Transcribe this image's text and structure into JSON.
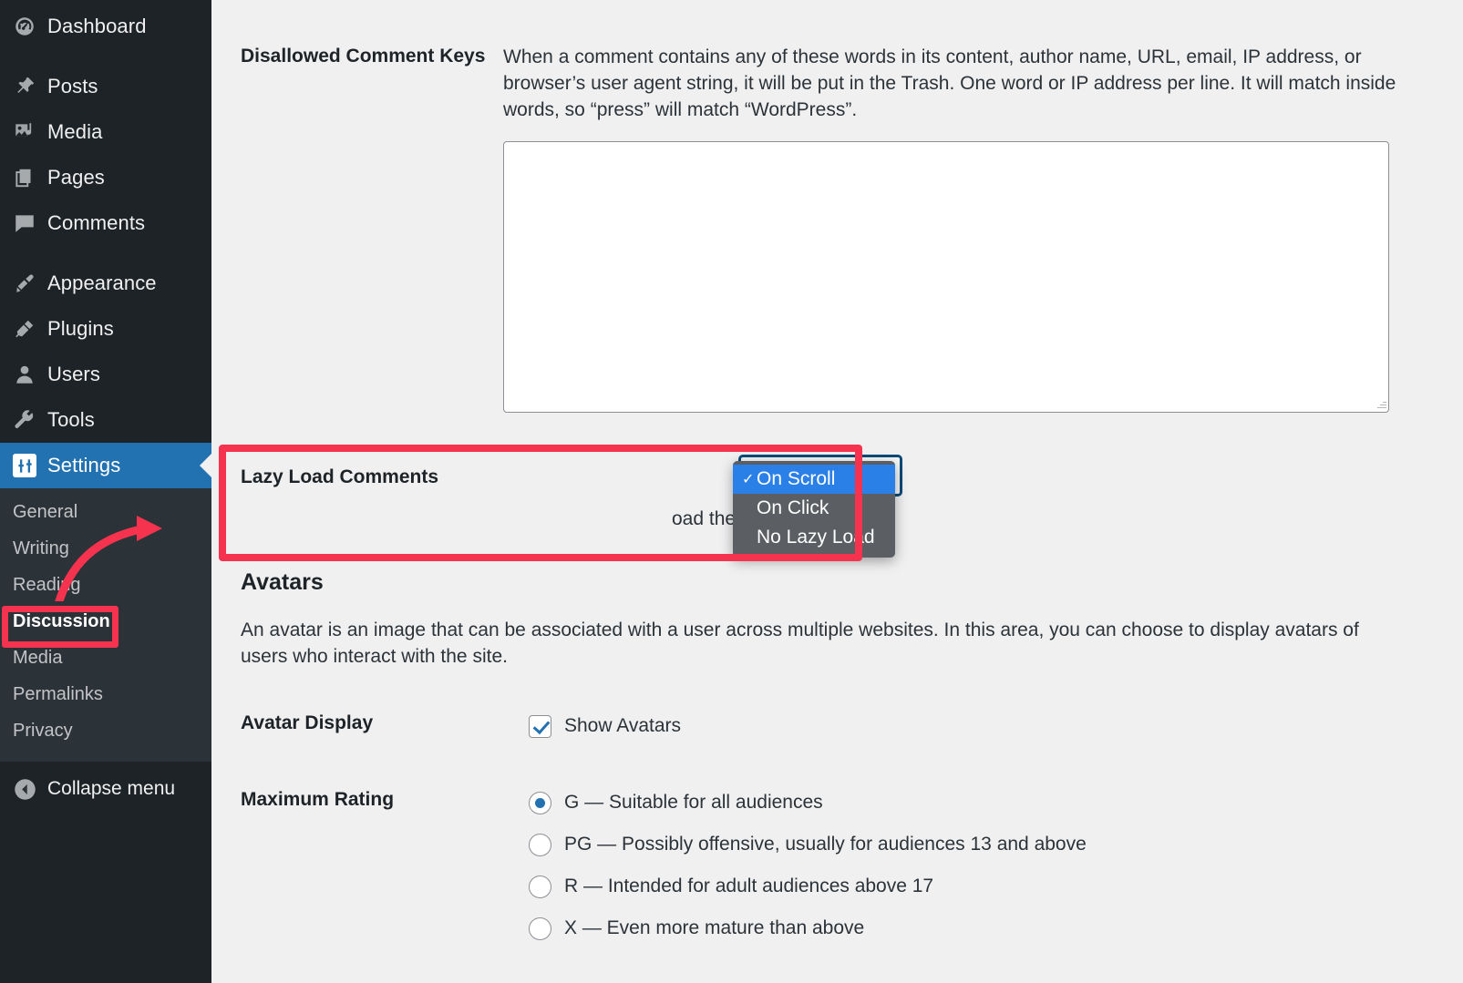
{
  "sidebar": {
    "items": [
      {
        "label": "Dashboard",
        "icon": "dashboard-icon"
      },
      {
        "label": "Posts",
        "icon": "pin-icon"
      },
      {
        "label": "Media",
        "icon": "media-icon"
      },
      {
        "label": "Pages",
        "icon": "pages-icon"
      },
      {
        "label": "Comments",
        "icon": "comment-bubble-icon"
      },
      {
        "label": "Appearance",
        "icon": "paintbrush-icon"
      },
      {
        "label": "Plugins",
        "icon": "plug-icon"
      },
      {
        "label": "Users",
        "icon": "user-icon"
      },
      {
        "label": "Tools",
        "icon": "wrench-icon"
      },
      {
        "label": "Settings",
        "icon": "settings-sliders-icon"
      }
    ],
    "submenu": [
      "General",
      "Writing",
      "Reading",
      "Discussion",
      "Media",
      "Permalinks",
      "Privacy"
    ],
    "active_menu": "Settings",
    "active_submenu": "Discussion",
    "collapse": {
      "label": "Collapse menu",
      "icon": "collapse-left-arrow-icon"
    }
  },
  "main": {
    "disallowed": {
      "label": "Disallowed Comment Keys",
      "description": "When a comment contains any of these words in its content, author name, URL, email, IP address, or browser’s user agent string, it will be put in the Trash. One word or IP address per line. It will match inside words, so “press” will match “WordPress”.",
      "textarea_value": "",
      "textarea_placeholder": ""
    },
    "lazy_load": {
      "label": "Lazy Load Comments",
      "description_tail": "oad the comments.",
      "selected_value": "On Scroll",
      "options": [
        {
          "label": "On Scroll",
          "selected": true
        },
        {
          "label": "On Click",
          "selected": false
        },
        {
          "label": "No Lazy Load",
          "selected": false
        }
      ]
    },
    "avatars": {
      "heading": "Avatars",
      "description": "An avatar is an image that can be associated with a user across multiple websites. In this area, you can choose to display avatars of users who interact with the site.",
      "avatar_display": {
        "label": "Avatar Display",
        "checkbox_label": "Show Avatars",
        "checked": true
      },
      "maximum_rating": {
        "label": "Maximum Rating",
        "options": [
          {
            "label": "G — Suitable for all audiences",
            "selected": true
          },
          {
            "label": "PG — Possibly offensive, usually for audiences 13 and above",
            "selected": false
          },
          {
            "label": "R — Intended for adult audiences above 17",
            "selected": false
          },
          {
            "label": "X — Even more mature than above",
            "selected": false
          }
        ]
      }
    }
  },
  "annotations": {
    "color": "#f5334f",
    "highlight_target": "Lazy Load Comments",
    "highlight_menu": "Discussion"
  },
  "colors": {
    "sidebar_bg": "#1d2327",
    "submenu_bg": "#2c3338",
    "accent_blue": "#2271b1",
    "content_bg": "#f0f0f1",
    "dropdown_bg": "#5b5e62",
    "dropdown_highlight": "#2b80e8",
    "annotation_red": "#f5334f"
  }
}
